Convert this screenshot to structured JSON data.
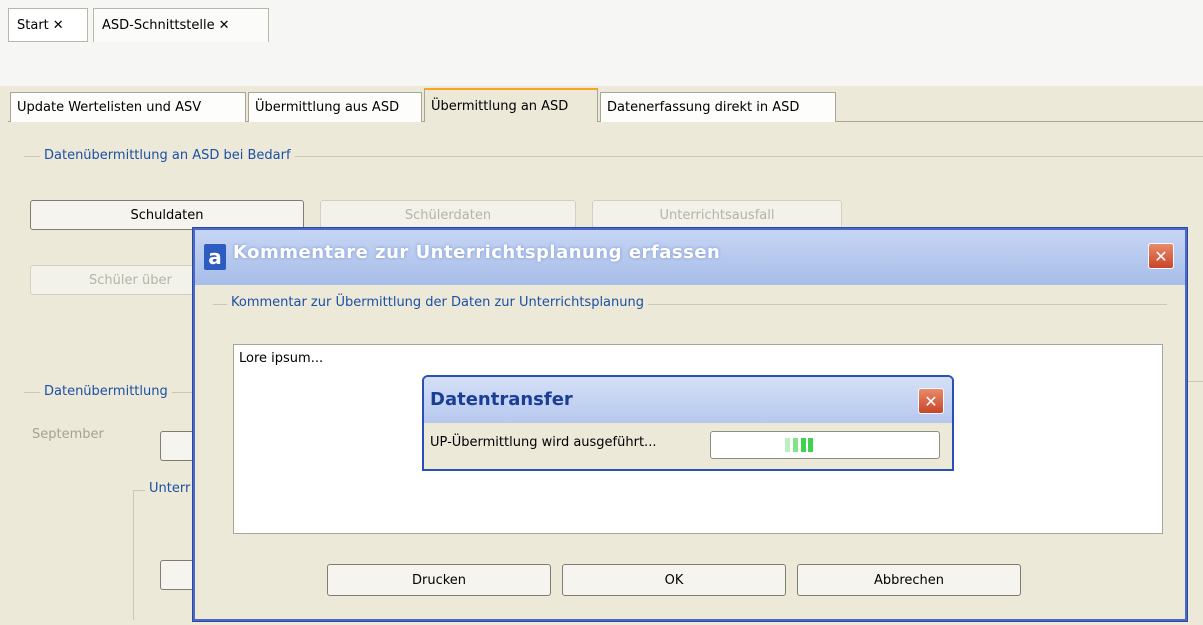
{
  "doc_tabs": [
    {
      "label": "Start",
      "close": "✕"
    },
    {
      "label": "ASD-Schnittstelle",
      "close": "✕"
    }
  ],
  "inner_tabs": [
    {
      "label": "Update Wertelisten und ASV"
    },
    {
      "label": "Übermittlung aus ASD"
    },
    {
      "label": "Übermittlung an ASD"
    },
    {
      "label": "Datenerfassung direkt in ASD"
    }
  ],
  "panel": {
    "group1_title": "Datenübermittlung an ASD bei Bedarf",
    "buttons": {
      "schuldaten": "Schuldaten",
      "schuelerdaten": "Schülerdaten",
      "unterrichtsausfall": "Unterrichtsausfall",
      "schueler_ueber": "Schüler über"
    },
    "group2_title_fragment": "Datenübermittlung",
    "september_label": "September",
    "unterr_fragment": "Unterr"
  },
  "dialog": {
    "title": "Kommentare zur Unterrichtsplanung erfassen",
    "group_title": "Kommentar zur Übermittlung der Daten zur Unterrichtsplanung",
    "comment_text": "Lore ipsum...",
    "buttons": {
      "print": "Drucken",
      "ok": "OK",
      "cancel": "Abbrechen"
    }
  },
  "progress_dialog": {
    "title": "Datentransfer",
    "message": "UP-Übermittlung wird ausgeführt..."
  },
  "colors": {
    "accent_tab": "#f5a623",
    "group_title": "#1c4fa5",
    "progress": "#3fd24c"
  },
  "icons": {
    "app": "a"
  }
}
